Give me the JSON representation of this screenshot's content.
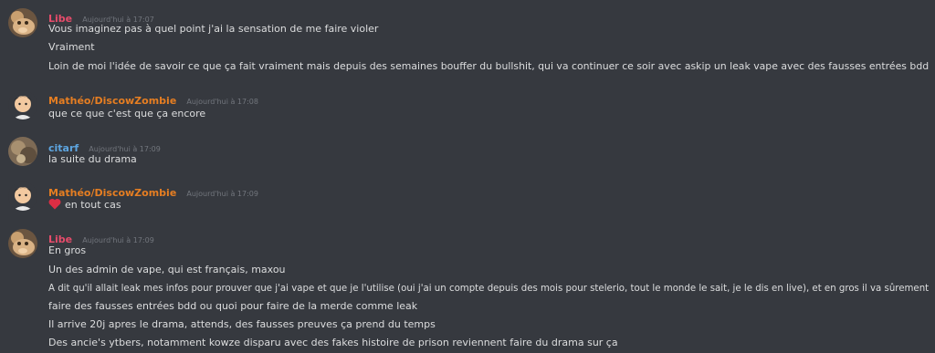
{
  "colors": {
    "libe": "#e74c6b",
    "matheo": "#e67e22",
    "citarf": "#5da5e0"
  },
  "messages": [
    {
      "author": "Libe",
      "timestamp": "Aujourd'hui à 17:07",
      "lines": [
        "Vous imaginez pas à quel point j'ai la sensation de me faire violer",
        "Vraiment",
        "Loin de moi l'idée de savoir ce que ça fait vraiment mais depuis des semaines bouffer du bullshit, qui va continuer ce soir avec askip un leak vape avec des fausses entrées bdd"
      ]
    },
    {
      "author": "Mathéo/DiscowZombie",
      "timestamp": "Aujourd'hui à 17:08",
      "lines": [
        "que ce que c'est que ça encore"
      ]
    },
    {
      "author": "citarf",
      "timestamp": "Aujourd'hui à 17:09",
      "lines": [
        "la suite du drama"
      ]
    },
    {
      "author": "Mathéo/DiscowZombie",
      "timestamp": "Aujourd'hui à 17:09",
      "lines": [
        "en tout cas"
      ]
    },
    {
      "author": "Libe",
      "timestamp": "Aujourd'hui à 17:09",
      "lines": [
        "En gros",
        "Un des admin de vape, qui est français, maxou",
        "A dit qu'il allait leak mes infos pour prouver que j'ai vape et que je l'utilise (oui j'ai un compte depuis des mois pour stelerio, tout le monde le sait, je le dis en live), et en gros il va sûrement",
        "faire des fausses entrées bdd ou quoi pour faire de la merde comme leak",
        "Il arrive 20j apres le drama, attends, des fausses preuves ça prend du temps",
        "Des ancie's ytbers, notamment kowze disparu avec des fakes histoire de prison reviennent faire du drama sur ça"
      ]
    }
  ]
}
